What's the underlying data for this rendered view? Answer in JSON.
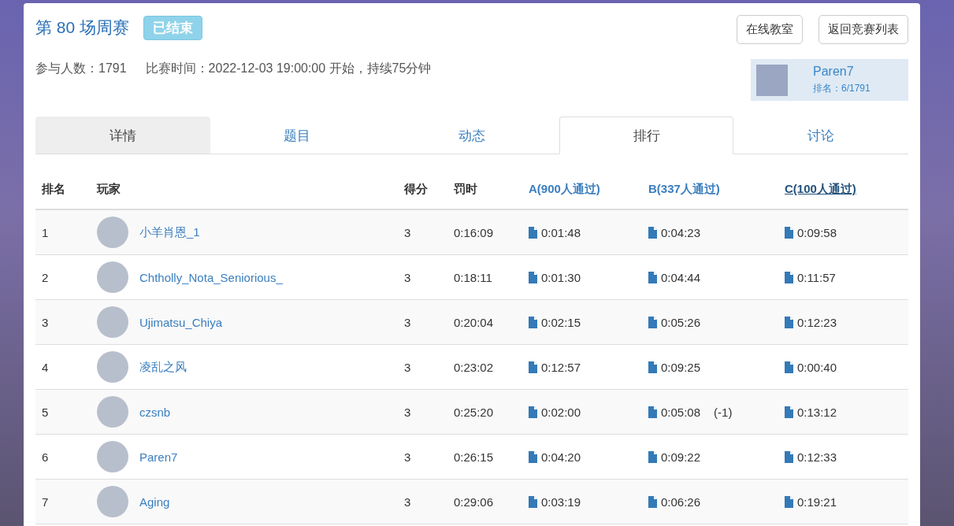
{
  "contest": {
    "title": "第 80 场周赛",
    "status": "已结束",
    "participants": "参与人数：1791",
    "time": "比赛时间：2022-12-03 19:00:00 开始，持续75分钟"
  },
  "buttons": [
    "在线教室",
    "返回竞赛列表"
  ],
  "me": {
    "name": "Paren7",
    "rank": "排名：6/1791"
  },
  "tabs": [
    {
      "label": "详情",
      "selected": false,
      "shaded": true
    },
    {
      "label": "题目",
      "selected": false,
      "shaded": false
    },
    {
      "label": "动态",
      "selected": false,
      "shaded": false
    },
    {
      "label": "排行",
      "selected": true,
      "shaded": false
    },
    {
      "label": "讨论",
      "selected": false,
      "shaded": false
    }
  ],
  "table": {
    "columns": [
      {
        "label": "排名",
        "kind": "plain",
        "hovered": false
      },
      {
        "label": "玩家",
        "kind": "plain",
        "hovered": false
      },
      {
        "label": "得分",
        "kind": "plain",
        "hovered": false
      },
      {
        "label": "罚时",
        "kind": "plain",
        "hovered": false
      },
      {
        "label": "A(900人通过)",
        "kind": "problem",
        "hovered": false
      },
      {
        "label": "B(337人通过)",
        "kind": "problem",
        "hovered": false
      },
      {
        "label": "C(100人通过)",
        "kind": "problem",
        "hovered": true
      }
    ],
    "rows": [
      {
        "rank": "1",
        "player": "小羊肖恩_1",
        "score": "3",
        "penalty": "0:16:09",
        "problems": [
          {
            "time": "0:01:48"
          },
          {
            "time": "0:04:23"
          },
          {
            "time": "0:09:58"
          }
        ]
      },
      {
        "rank": "2",
        "player": "Chtholly_Nota_Seniorious_",
        "score": "3",
        "penalty": "0:18:11",
        "problems": [
          {
            "time": "0:01:30"
          },
          {
            "time": "0:04:44"
          },
          {
            "time": "0:11:57"
          }
        ]
      },
      {
        "rank": "3",
        "player": "Ujimatsu_Chiya",
        "score": "3",
        "penalty": "0:20:04",
        "problems": [
          {
            "time": "0:02:15"
          },
          {
            "time": "0:05:26"
          },
          {
            "time": "0:12:23"
          }
        ]
      },
      {
        "rank": "4",
        "player": "凌乱之风",
        "score": "3",
        "penalty": "0:23:02",
        "problems": [
          {
            "time": "0:12:57"
          },
          {
            "time": "0:09:25"
          },
          {
            "time": "0:00:40"
          }
        ]
      },
      {
        "rank": "5",
        "player": "czsnb",
        "score": "3",
        "penalty": "0:25:20",
        "problems": [
          {
            "time": "0:02:00"
          },
          {
            "time": "0:05:08",
            "wrong": "(-1)"
          },
          {
            "time": "0:13:12"
          }
        ]
      },
      {
        "rank": "6",
        "player": "Paren7",
        "score": "3",
        "penalty": "0:26:15",
        "problems": [
          {
            "time": "0:04:20"
          },
          {
            "time": "0:09:22"
          },
          {
            "time": "0:12:33"
          }
        ]
      },
      {
        "rank": "7",
        "player": "Aging",
        "score": "3",
        "penalty": "0:29:06",
        "problems": [
          {
            "time": "0:03:19"
          },
          {
            "time": "0:06:26"
          },
          {
            "time": "0:19:21"
          }
        ]
      }
    ]
  }
}
